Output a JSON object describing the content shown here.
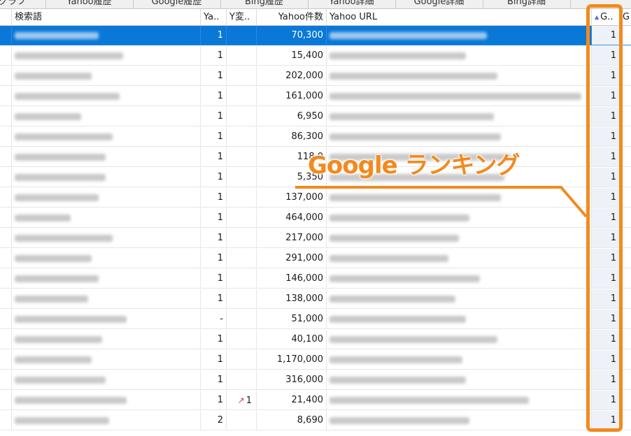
{
  "tabs": [
    "グラフ",
    "Yahoo履歴",
    "Google履歴",
    "Bing履歴",
    "Yahoo詳細",
    "Google詳細",
    "Bing詳細"
  ],
  "columns": {
    "keyword": "検索語",
    "yahoo_rank": "Ya..",
    "y_change": "Y変..",
    "yahoo_count": "Yahoo件数",
    "yahoo_url": "Yahoo URL",
    "google_rank": "G..",
    "extra": "G"
  },
  "rows": [
    {
      "yahoo_rank": "1",
      "y_change": "",
      "yahoo_count": "70,300",
      "google_rank": "1",
      "selected": true
    },
    {
      "yahoo_rank": "1",
      "y_change": "",
      "yahoo_count": "15,400",
      "google_rank": "1"
    },
    {
      "yahoo_rank": "1",
      "y_change": "",
      "yahoo_count": "202,000",
      "google_rank": "1"
    },
    {
      "yahoo_rank": "1",
      "y_change": "",
      "yahoo_count": "161,000",
      "google_rank": "1"
    },
    {
      "yahoo_rank": "1",
      "y_change": "",
      "yahoo_count": "6,950",
      "google_rank": "1"
    },
    {
      "yahoo_rank": "1",
      "y_change": "",
      "yahoo_count": "86,300",
      "google_rank": "1"
    },
    {
      "yahoo_rank": "1",
      "y_change": "",
      "yahoo_count": "118,0",
      "google_rank": "1"
    },
    {
      "yahoo_rank": "1",
      "y_change": "",
      "yahoo_count": "5,350",
      "google_rank": "1"
    },
    {
      "yahoo_rank": "1",
      "y_change": "",
      "yahoo_count": "137,000",
      "google_rank": "1"
    },
    {
      "yahoo_rank": "1",
      "y_change": "",
      "yahoo_count": "464,000",
      "google_rank": "1"
    },
    {
      "yahoo_rank": "1",
      "y_change": "",
      "yahoo_count": "217,000",
      "google_rank": "1"
    },
    {
      "yahoo_rank": "1",
      "y_change": "",
      "yahoo_count": "291,000",
      "google_rank": "1"
    },
    {
      "yahoo_rank": "1",
      "y_change": "",
      "yahoo_count": "146,000",
      "google_rank": "1"
    },
    {
      "yahoo_rank": "1",
      "y_change": "",
      "yahoo_count": "138,000",
      "google_rank": "1"
    },
    {
      "yahoo_rank": "-",
      "y_change": "",
      "yahoo_count": "51,000",
      "google_rank": "1"
    },
    {
      "yahoo_rank": "1",
      "y_change": "",
      "yahoo_count": "40,100",
      "google_rank": "1"
    },
    {
      "yahoo_rank": "1",
      "y_change": "",
      "yahoo_count": "1,170,000",
      "google_rank": "1"
    },
    {
      "yahoo_rank": "1",
      "y_change": "",
      "yahoo_count": "316,000",
      "google_rank": "1"
    },
    {
      "yahoo_rank": "1",
      "y_change": "1",
      "yahoo_count": "21,400",
      "google_rank": "1",
      "trend_icon": "trend-up-arrow-icon"
    },
    {
      "yahoo_rank": "2",
      "y_change": "",
      "yahoo_count": "8,690",
      "google_rank": "1"
    }
  ],
  "annotation": {
    "label": "Google ランキング",
    "color": "#f28a1e"
  },
  "colors": {
    "selection": "#0a78d7",
    "trend_up": "#d23b3b"
  }
}
